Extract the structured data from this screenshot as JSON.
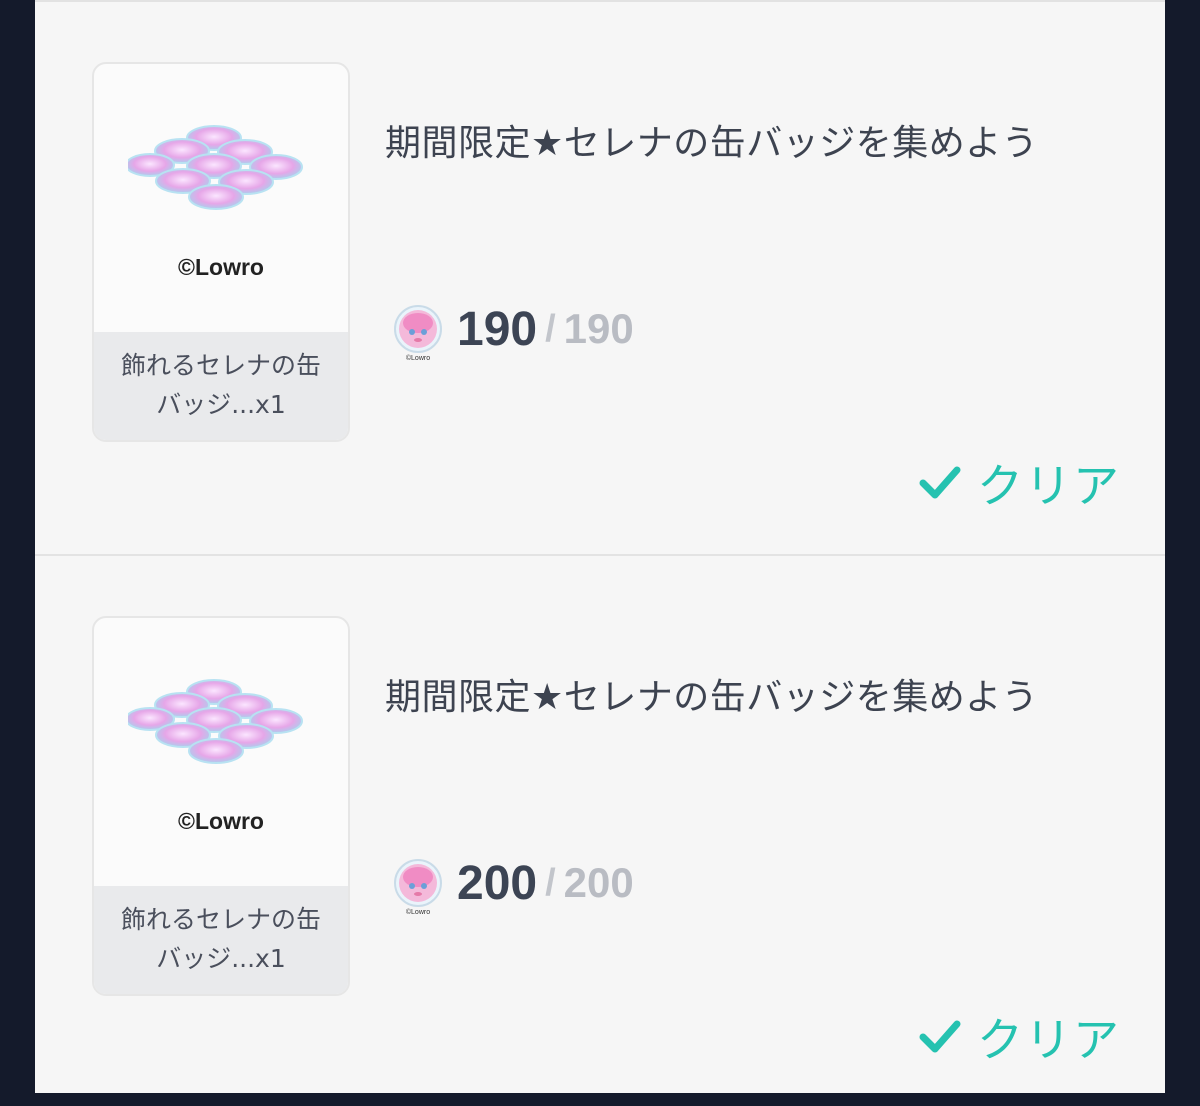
{
  "missions": [
    {
      "reward": {
        "image_icon": "badge-pile-icon",
        "copyright": "©Lowro",
        "caption_line1": "飾れるセレナの缶",
        "caption_line2": "バッジ...x1"
      },
      "title": "期間限定★セレナの缶バッジを集めよう",
      "progress": {
        "avatar_icon": "badge-avatar-icon",
        "avatar_caption": "©Lowro",
        "current": "190",
        "separator": "/",
        "target": "190"
      },
      "status": {
        "icon": "checkmark-icon",
        "label": "クリア"
      }
    },
    {
      "reward": {
        "image_icon": "badge-pile-icon",
        "copyright": "©Lowro",
        "caption_line1": "飾れるセレナの缶",
        "caption_line2": "バッジ...x1"
      },
      "title": "期間限定★セレナの缶バッジを集めよう",
      "progress": {
        "avatar_icon": "badge-avatar-icon",
        "avatar_caption": "©Lowro",
        "current": "200",
        "separator": "/",
        "target": "200"
      },
      "status": {
        "icon": "checkmark-icon",
        "label": "クリア"
      }
    }
  ],
  "colors": {
    "background": "#141a2b",
    "panel": "#f6f6f6",
    "accent_clear": "#25c2b0",
    "text_main": "#3d4350",
    "text_muted": "#b9bcc3"
  }
}
